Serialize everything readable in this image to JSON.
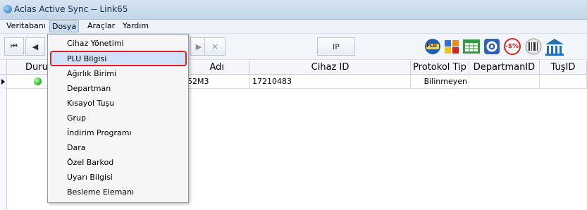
{
  "window": {
    "title": "Aclas Active Sync -- Link65"
  },
  "menubar": {
    "items": [
      "Veritabanı",
      "Dosya",
      "Araçlar",
      "Yardım"
    ],
    "active": "Dosya"
  },
  "toolbar": {
    "first_label": "⏮",
    "prev_label": "◀",
    "next_label": "▶",
    "last_label": "⏭",
    "cancel_label": "✕",
    "ip_label": "IP",
    "plu_label": "PLU",
    "discount_label": "-$%",
    "icon_colors": {
      "plu": "#1f5fb0",
      "green": "#2f9d3d",
      "orange": "#f08a1a",
      "gear": "#3060b8",
      "discount": "#d9241c",
      "bank": "#1e6fb7"
    }
  },
  "grid": {
    "columns": [
      "Durum",
      "Adı",
      "Cihaz ID",
      "Protokol Tip",
      "DepartmanID",
      "TuşID"
    ],
    "rows": [
      {
        "status": "online",
        "name": "52M3",
        "device_id": "17210483",
        "protocol": "Bilinmeyen",
        "department": "",
        "key": ""
      }
    ],
    "status_color": "#2fbf2a"
  },
  "dropdown": {
    "items": [
      "Cihaz Yönetimi",
      "PLU Bilgisi",
      "Ağırlık Birimi",
      "Departman",
      "Kısayol Tuşu",
      "Grup",
      "İndirim Programı",
      "Dara",
      "Özel Barkod",
      "Uyarı Bilgisi",
      "Besleme Elemanı"
    ],
    "highlighted": "PLU Bilgisi",
    "highlight_border": "#e0201a"
  }
}
